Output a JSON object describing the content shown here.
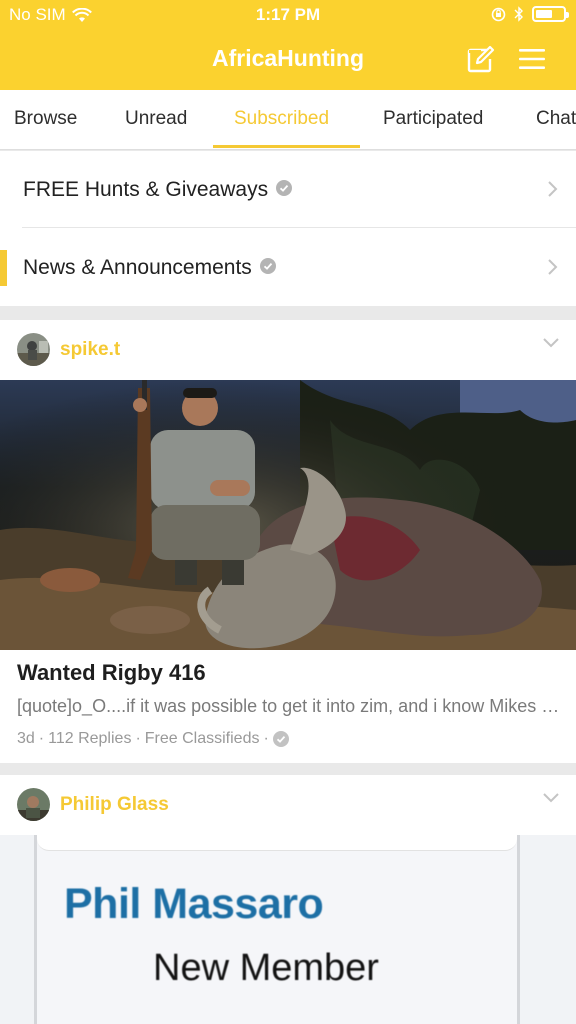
{
  "status_bar": {
    "carrier": "No SIM",
    "time": "1:17 PM",
    "battery_level": 0.6
  },
  "nav": {
    "title": "AfricaHunting",
    "icons": [
      "compose-icon",
      "menu-icon"
    ]
  },
  "tabs": [
    {
      "label": "Browse",
      "active": false
    },
    {
      "label": "Unread",
      "active": false
    },
    {
      "label": "Subscribed",
      "active": true
    },
    {
      "label": "Participated",
      "active": false
    },
    {
      "label": "Chat",
      "active": false
    }
  ],
  "forums": [
    {
      "label": "FREE Hunts & Giveaways",
      "verified": true,
      "unread": false
    },
    {
      "label": "News & Announcements",
      "verified": true,
      "unread": true
    }
  ],
  "posts": [
    {
      "username": "spike.t",
      "title": "Wanted Rigby 416",
      "preview": "[quote]o_O....if it was possible to get it into zim, and i know Mikes have set up a program...",
      "age": "3d",
      "replies": "112 Replies",
      "forum": "Free Classifieds"
    },
    {
      "username": "Philip Glass",
      "signature_name": "Phil Massaro",
      "signature_role": "New Member"
    }
  ],
  "colors": {
    "accent": "#fbd22f",
    "tab_active": "#f5c934",
    "text": "#222222",
    "meta": "#999999"
  }
}
